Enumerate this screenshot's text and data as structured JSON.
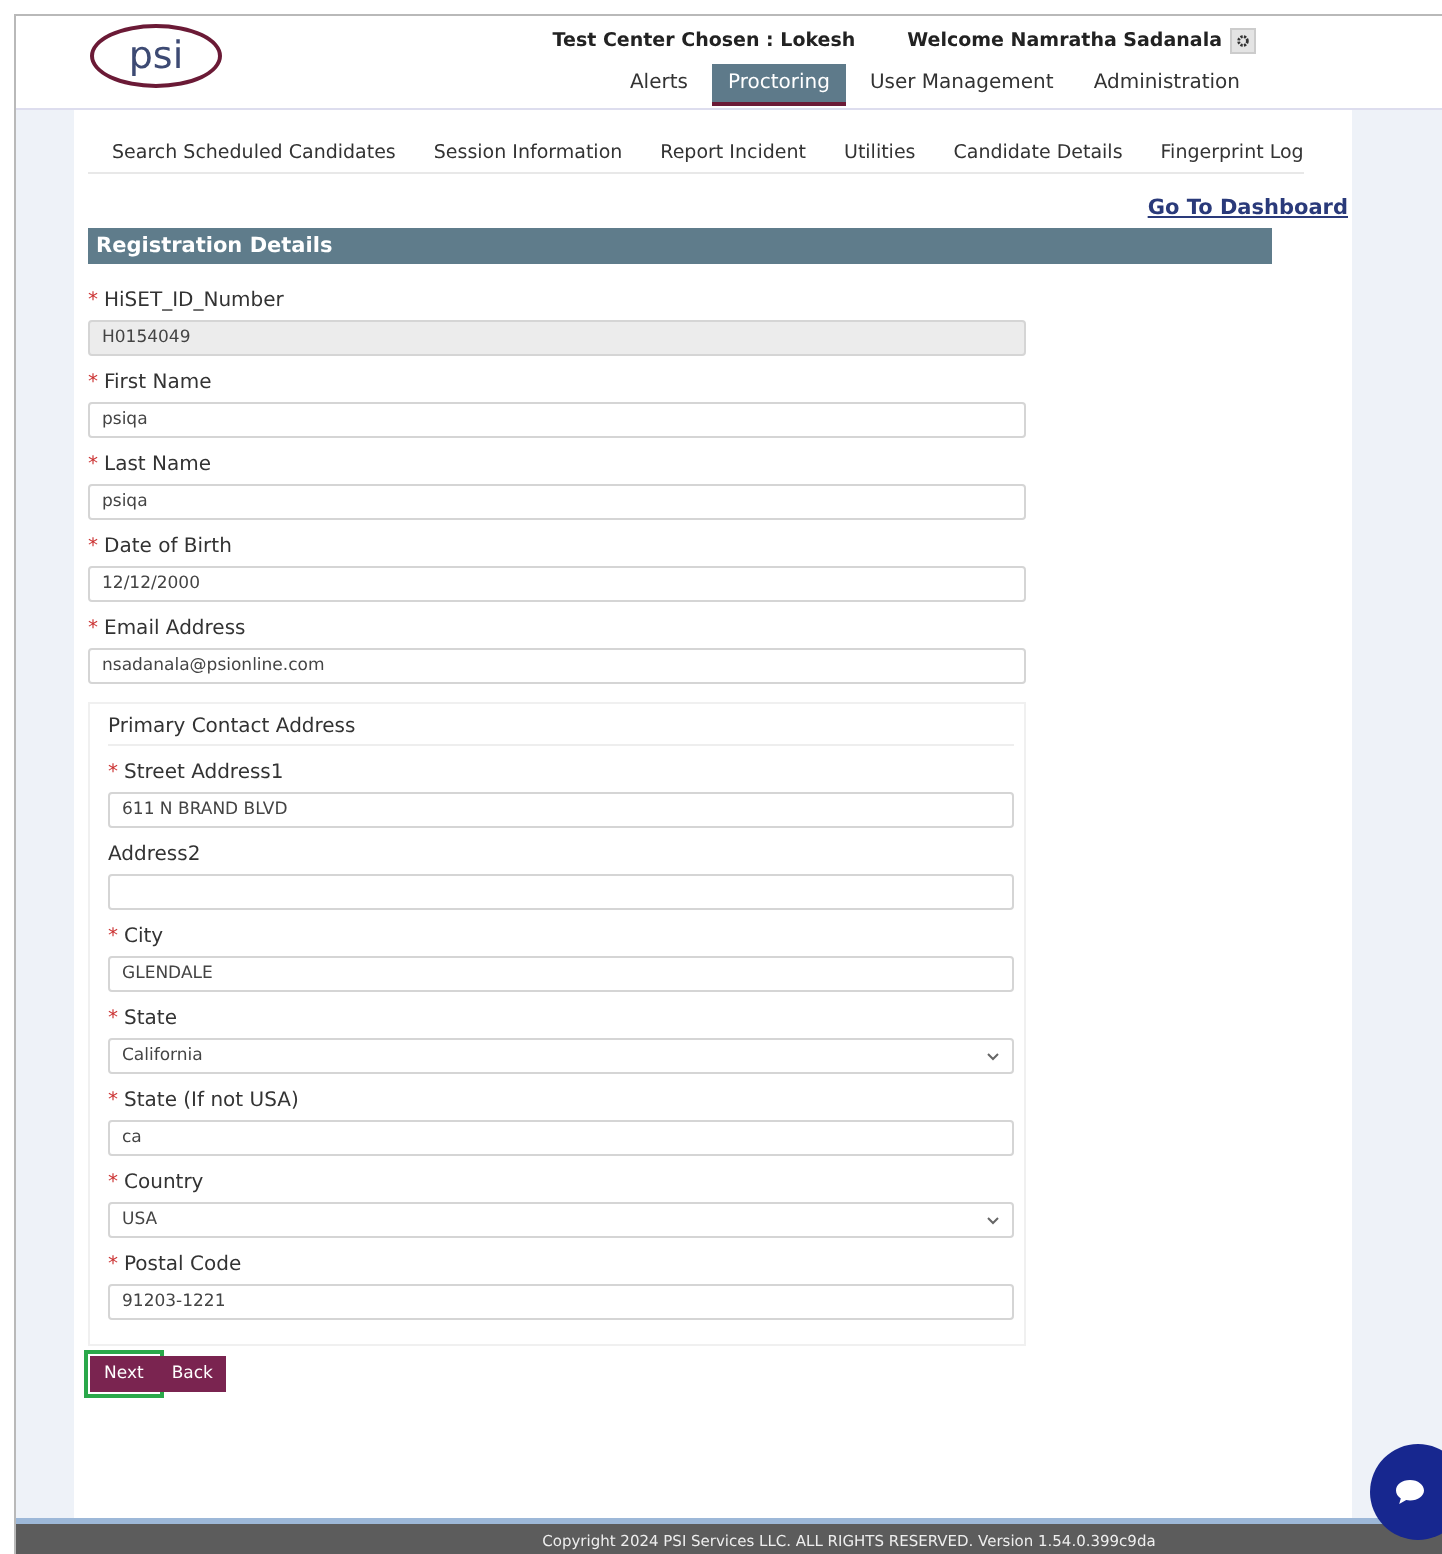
{
  "header": {
    "logo": "psi",
    "test_center": "Test Center Chosen : Lokesh",
    "welcome": "Welcome Namratha Sadanala",
    "nav": [
      {
        "label": "Alerts",
        "selected": false
      },
      {
        "label": "Proctoring",
        "selected": true
      },
      {
        "label": "User Management",
        "selected": false
      },
      {
        "label": "Administration",
        "selected": false
      }
    ]
  },
  "subnav": [
    "Search Scheduled Candidates",
    "Session Information",
    "Report Incident",
    "Utilities",
    "Candidate Details",
    "Fingerprint Log"
  ],
  "dashboard_link": "Go To Dashboard",
  "panel_title": "Registration Details",
  "fields": [
    {
      "kind": "text",
      "mark": "*",
      "label": "HiSET_ID_Number",
      "value": "H0154049",
      "disabled": true
    },
    {
      "kind": "text",
      "mark": "*",
      "label": "First Name",
      "value": "psiqa",
      "disabled": false
    },
    {
      "kind": "text",
      "mark": "*",
      "label": "Last Name",
      "value": "psiqa",
      "disabled": false
    },
    {
      "kind": "text",
      "mark": "*",
      "label": "Date of Birth",
      "value": "12/12/2000",
      "disabled": false
    },
    {
      "kind": "text",
      "mark": "*",
      "label": "Email Address",
      "value": "nsadanala@psionline.com",
      "disabled": false
    }
  ],
  "address": {
    "title": "Primary Contact Address",
    "fields": [
      {
        "kind": "text",
        "mark": "*",
        "label": "Street Address1",
        "value": "611 N BRAND BLVD"
      },
      {
        "kind": "text",
        "label": "Address2"
      },
      {
        "kind": "text",
        "mark": "*",
        "label": "City",
        "value": "GLENDALE"
      },
      {
        "kind": "select",
        "mark": "*",
        "label": "State",
        "value": "California"
      },
      {
        "kind": "text",
        "mark": "*",
        "label": "State (If not USA)",
        "value": "ca"
      },
      {
        "kind": "select",
        "mark": "*",
        "label": "Country",
        "value": "USA"
      },
      {
        "kind": "text",
        "mark": "*",
        "label": "Postal Code",
        "value": "91203-1221"
      }
    ]
  },
  "buttons": [
    {
      "label": "Next",
      "focused": true
    },
    {
      "label": "Back",
      "focused": false
    }
  ],
  "footer": "Copyright 2024 PSI Services LLC. ALL RIGHTS RESERVED. Version 1.54.0.399c9da"
}
